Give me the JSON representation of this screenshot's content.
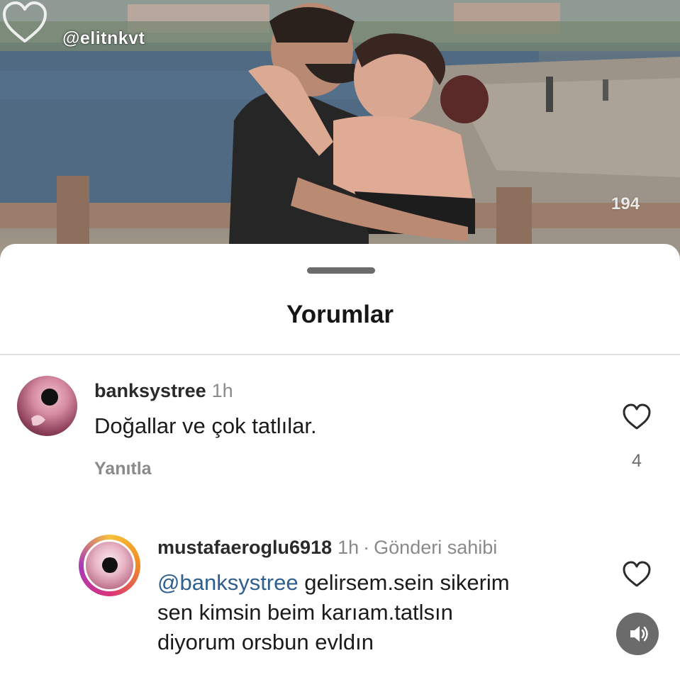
{
  "post": {
    "watermark": "@elitnkvt",
    "like_count": "194",
    "like_icon": "heart-outline-icon"
  },
  "comments_sheet": {
    "title": "Yorumlar"
  },
  "comments": [
    {
      "username": "banksystree",
      "time": "1h",
      "text": "Doğallar ve çok tatlılar.",
      "reply_label": "Yanıtla",
      "likes": "4"
    },
    {
      "username": "mustafaeroglu6918",
      "time": "1h",
      "separator": "·",
      "owner_badge": "Gönderi sahibi",
      "mention": "@banksystree",
      "text_line1": " gelirsem.sein sikerim",
      "text_line2": "sen kimsin beim karıam.tatlsın",
      "text_line3": "diyorum orsbun evldın"
    }
  ],
  "colors": {
    "mention": "#2f5f8f",
    "secondary_text": "#8a8a8a",
    "primary_text": "#1b1b1b"
  }
}
